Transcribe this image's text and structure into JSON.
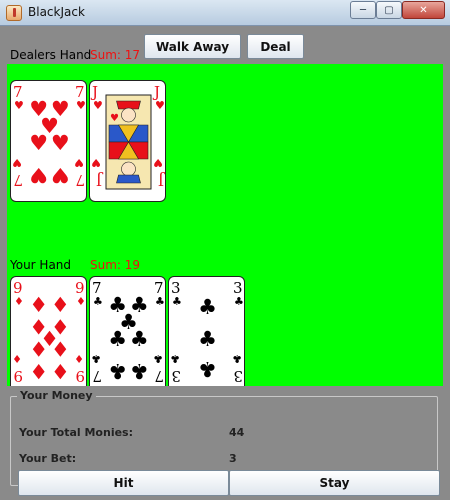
{
  "window": {
    "title": "BlackJack",
    "minimize": "─",
    "maximize": "▢",
    "close": "✕"
  },
  "toolbar": {
    "walk_away": "Walk Away",
    "deal": "Deal"
  },
  "dealer": {
    "label": "Dealers Hand",
    "sum": "Sum: 17",
    "cards": [
      {
        "rank": "7",
        "suit": "hearts"
      },
      {
        "rank": "J",
        "suit": "hearts"
      }
    ]
  },
  "player": {
    "label": "Your Hand",
    "sum": "Sum: 19",
    "cards": [
      {
        "rank": "9",
        "suit": "diamonds"
      },
      {
        "rank": "7",
        "suit": "clubs"
      },
      {
        "rank": "3",
        "suit": "clubs"
      }
    ]
  },
  "money": {
    "title": "Your Money",
    "total_label": "Your Total Monies:",
    "total_value": "44",
    "bet_label": "Your Bet:",
    "bet_value": "3",
    "hit": "Hit",
    "stay": "Stay"
  },
  "colors": {
    "table": "#00ff00",
    "red_suit": "#e8101a",
    "black_suit": "#000000",
    "sum_text": "#e11111"
  }
}
